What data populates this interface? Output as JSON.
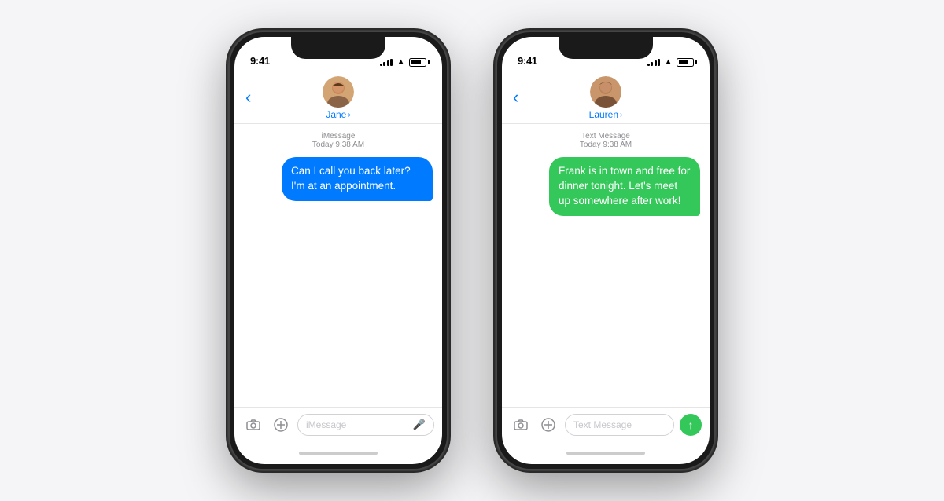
{
  "background_color": "#f5f5f7",
  "phone1": {
    "status": {
      "time": "9:41",
      "signal_bars": 4,
      "wifi": true,
      "battery_pct": 75
    },
    "contact": {
      "name": "Jane",
      "avatar_color": "#c8a882"
    },
    "message_type_label": "iMessage",
    "message_timestamp": "Today 9:38 AM",
    "message_text": "Can I call you back later? I'm at an appointment.",
    "bubble_color": "#007AFF",
    "input_placeholder": "iMessage",
    "back_label": "‹",
    "chevron": "›"
  },
  "phone2": {
    "status": {
      "time": "9:41",
      "signal_bars": 4,
      "wifi": true,
      "battery_pct": 75
    },
    "contact": {
      "name": "Lauren",
      "avatar_color": "#b8956a"
    },
    "message_type_label": "Text Message",
    "message_timestamp": "Today 9:38 AM",
    "message_text": "Frank is in town and free for dinner tonight. Let's meet up somewhere after work!",
    "bubble_color": "#34C759",
    "input_placeholder": "Text Message",
    "back_label": "‹",
    "chevron": "›",
    "send_button_visible": true
  }
}
